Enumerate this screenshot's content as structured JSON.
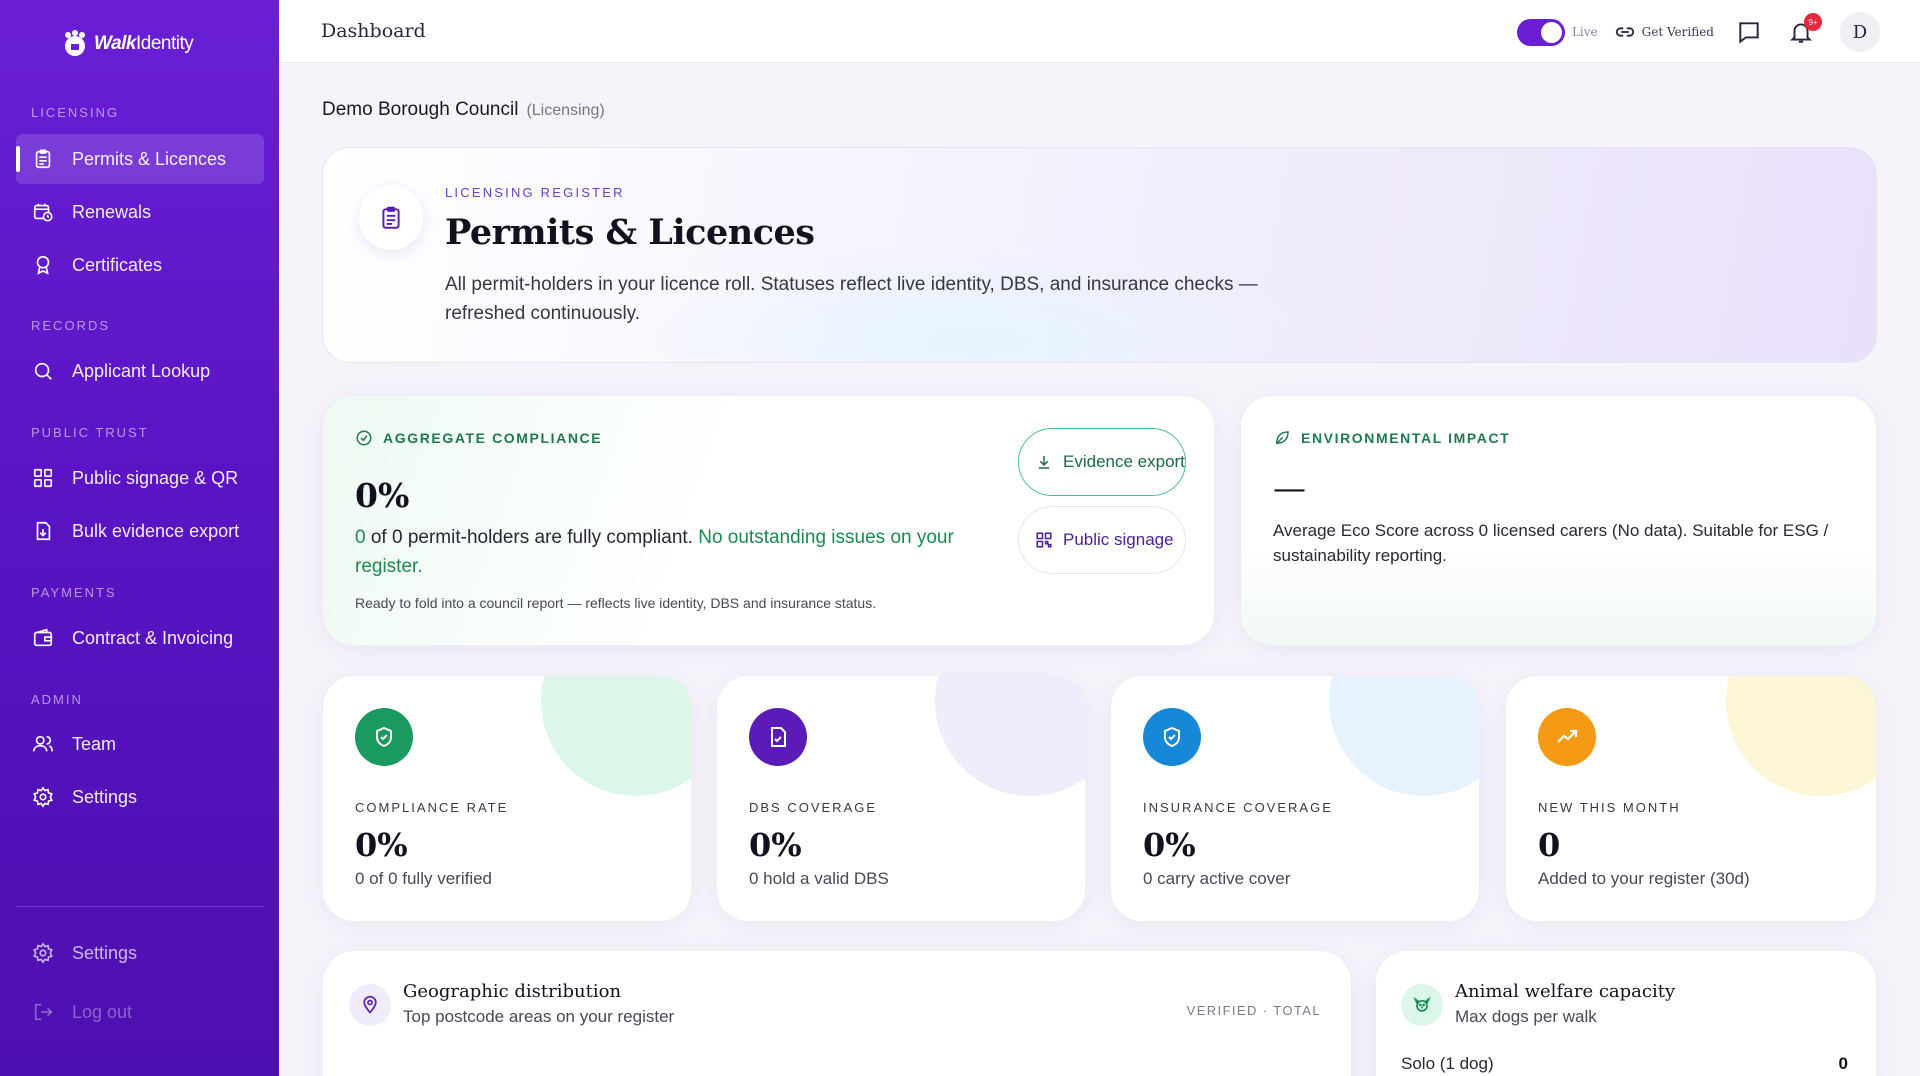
{
  "app": {
    "brand_bold": "Walk",
    "brand_light": "Identity"
  },
  "sidebar": {
    "sections": {
      "licensing": "LICENSING",
      "records": "RECORDS",
      "public_trust": "PUBLIC TRUST",
      "payments": "PAYMENTS",
      "admin": "ADMIN"
    },
    "items": [
      {
        "label": "Permits & Licences",
        "icon": "clipboard-icon",
        "active": true
      },
      {
        "label": "Renewals",
        "icon": "calendar-clock-icon"
      },
      {
        "label": "Certificates",
        "icon": "award-icon"
      },
      {
        "label": "Applicant Lookup",
        "icon": "search-icon"
      },
      {
        "label": "Public signage & QR",
        "icon": "qr-grid-icon"
      },
      {
        "label": "Bulk evidence export",
        "icon": "file-download-icon"
      },
      {
        "label": "Contract & Invoicing",
        "icon": "wallet-icon"
      },
      {
        "label": "Team",
        "icon": "users-icon"
      },
      {
        "label": "Settings",
        "icon": "gear-icon"
      }
    ],
    "footer": {
      "settings": "Settings",
      "logout": "Log out"
    }
  },
  "topbar": {
    "title": "Dashboard",
    "live_label": "Live",
    "get_verified": "Get Verified",
    "notification_count": "9+",
    "avatar_initial": "D"
  },
  "org": {
    "name": "Demo Borough Council",
    "context": "(Licensing)"
  },
  "hero": {
    "kicker": "LICENSING REGISTER",
    "title": "Permits & Licences",
    "description": "All permit-holders in your licence roll. Statuses reflect live identity, DBS, and insurance checks — refreshed continuously."
  },
  "compliance": {
    "kicker": "AGGREGATE COMPLIANCE",
    "value": "0%",
    "count": "0",
    "text": " of 0 permit-holders are fully compliant. ",
    "status": "No outstanding issues on your register.",
    "footnote": "Ready to fold into a council report — reflects live identity, DBS and insurance status.",
    "evidence_export": "Evidence export",
    "public_signage": "Public signage"
  },
  "environment": {
    "kicker": "ENVIRONMENTAL IMPACT",
    "value": "—",
    "text": "Average Eco Score across 0 licensed carers (No data). Suitable for ESG / sustainability reporting."
  },
  "stats": [
    {
      "label": "COMPLIANCE RATE",
      "value": "0%",
      "sub": "0 of 0 fully verified",
      "color": "#1a9a5e",
      "blob": "#dcf7e9"
    },
    {
      "label": "DBS COVERAGE",
      "value": "0%",
      "sub": "0 hold a valid DBS",
      "color": "#5b1bb8",
      "blob": "#f1ecfb"
    },
    {
      "label": "INSURANCE COVERAGE",
      "value": "0%",
      "sub": "0 carry active cover",
      "color": "#1787d8",
      "blob": "#e6f2fd"
    },
    {
      "label": "NEW THIS MONTH",
      "value": "0",
      "sub": "Added to your register (30d)",
      "color": "#f59a14",
      "blob": "#fdf6d6"
    }
  ],
  "geo": {
    "title": "Geographic distribution",
    "subtitle": "Top postcode areas on your register",
    "right_label": "VERIFIED · TOTAL"
  },
  "animal": {
    "title": "Animal welfare capacity",
    "subtitle": "Max dogs per walk",
    "row_label": "Solo (1 dog)",
    "row_value": "0"
  }
}
